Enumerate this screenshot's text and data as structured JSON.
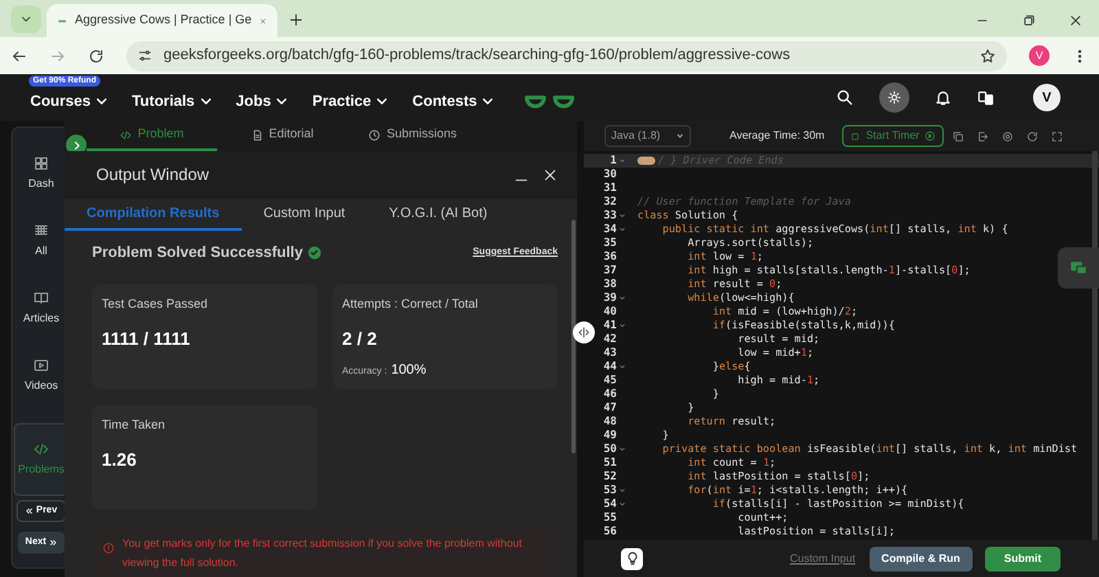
{
  "browser": {
    "tab_title": "Aggressive Cows | Practice | Ge",
    "url": "geeksforgeeks.org/batch/gfg-160-problems/track/searching-gfg-160/problem/aggressive-cows",
    "profile": "V"
  },
  "nav": {
    "badge": "Get 90% Refund",
    "menu": [
      "Courses",
      "Tutorials",
      "Jobs",
      "Practice",
      "Contests"
    ],
    "profile": "V"
  },
  "sidebar": {
    "items": [
      {
        "label": "Dash",
        "kind": "dash",
        "selected": false
      },
      {
        "label": "All",
        "kind": "all",
        "selected": false
      },
      {
        "label": "Articles",
        "kind": "articles",
        "selected": false
      },
      {
        "label": "Videos",
        "kind": "videos",
        "selected": false
      },
      {
        "label": "Problems",
        "kind": "problems",
        "selected": true
      }
    ],
    "prev": "Prev",
    "next": "Next"
  },
  "panel_tabs": [
    {
      "label": "Problem",
      "kind": "code",
      "selected": true
    },
    {
      "label": "Editorial",
      "kind": "doc",
      "selected": false
    },
    {
      "label": "Submissions",
      "kind": "clock",
      "selected": false
    }
  ],
  "output_window": {
    "title": "Output Window",
    "tabs": [
      {
        "label": "Compilation Results",
        "selected": true
      },
      {
        "label": "Custom Input",
        "selected": false
      },
      {
        "label": "Y.O.G.I. (AI Bot)",
        "selected": false
      }
    ],
    "status": "Problem Solved Successfully",
    "feedback": "Suggest Feedback",
    "cards": [
      {
        "label": "Test Cases Passed",
        "value": "1111 / 1111"
      },
      {
        "label": "Attempts : Correct / Total",
        "value": "2 / 2",
        "extra_label": "Accuracy :",
        "extra_value": "100%"
      },
      {
        "label": "Time Taken",
        "value": "1.26"
      }
    ],
    "note": "You get marks only for the first correct submission if you solve the problem without viewing the full solution."
  },
  "editor": {
    "language": "Java (1.8)",
    "average_time": "Average Time: 30m",
    "timer": "Start Timer",
    "lines": [
      {
        "number": "1",
        "foldable": true,
        "active": true,
        "folded": true,
        "tokens": [
          {
            "kind": "comment",
            "text": "/ } Driver Code Ends"
          }
        ]
      },
      {
        "number": "30",
        "foldable": false,
        "active": false
      },
      {
        "number": "31",
        "foldable": false,
        "active": false
      },
      {
        "number": "32",
        "foldable": false,
        "active": false,
        "tokens": [
          {
            "kind": "comment",
            "text": "// User function Template for Java"
          }
        ]
      },
      {
        "number": "33",
        "foldable": true,
        "active": false,
        "tokens": [
          {
            "kind": "keyword",
            "text": "class"
          },
          {
            "kind": "plain",
            "text": " Solution {"
          }
        ]
      },
      {
        "number": "34",
        "foldable": true,
        "active": false,
        "tokens": [
          {
            "kind": "keyword",
            "text": "    public static int"
          },
          {
            "kind": "plain",
            "text": " aggressiveCows("
          },
          {
            "kind": "keyword",
            "text": "int"
          },
          {
            "kind": "plain",
            "text": "[] stalls, "
          },
          {
            "kind": "keyword",
            "text": "int"
          },
          {
            "kind": "plain",
            "text": " k) {"
          }
        ]
      },
      {
        "number": "35",
        "foldable": false,
        "active": false,
        "tokens": [
          {
            "kind": "plain",
            "text": "        Arrays.sort(stalls);"
          }
        ]
      },
      {
        "number": "36",
        "foldable": false,
        "active": false,
        "tokens": [
          {
            "kind": "keyword",
            "text": "        int"
          },
          {
            "kind": "plain",
            "text": " low = "
          },
          {
            "kind": "number",
            "text": "1"
          },
          {
            "kind": "plain",
            "text": ";"
          }
        ]
      },
      {
        "number": "37",
        "foldable": false,
        "active": false,
        "tokens": [
          {
            "kind": "keyword",
            "text": "        int"
          },
          {
            "kind": "plain",
            "text": " high = stalls[stalls.length-"
          },
          {
            "kind": "number",
            "text": "1"
          },
          {
            "kind": "plain",
            "text": "]-stalls["
          },
          {
            "kind": "number",
            "text": "0"
          },
          {
            "kind": "plain",
            "text": "];"
          }
        ]
      },
      {
        "number": "38",
        "foldable": false,
        "active": false,
        "tokens": [
          {
            "kind": "keyword",
            "text": "        int"
          },
          {
            "kind": "plain",
            "text": " result = "
          },
          {
            "kind": "number",
            "text": "0"
          },
          {
            "kind": "plain",
            "text": ";"
          }
        ]
      },
      {
        "number": "39",
        "foldable": true,
        "active": false,
        "tokens": [
          {
            "kind": "keyword",
            "text": "        while"
          },
          {
            "kind": "plain",
            "text": "(low<=high){"
          }
        ]
      },
      {
        "number": "40",
        "foldable": false,
        "active": false,
        "tokens": [
          {
            "kind": "keyword",
            "text": "            int"
          },
          {
            "kind": "plain",
            "text": " mid = (low+high)/"
          },
          {
            "kind": "number",
            "text": "2"
          },
          {
            "kind": "plain",
            "text": ";"
          }
        ]
      },
      {
        "number": "41",
        "foldable": true,
        "active": false,
        "tokens": [
          {
            "kind": "keyword",
            "text": "            if"
          },
          {
            "kind": "plain",
            "text": "(isFeasible(stalls,k,mid)){"
          }
        ]
      },
      {
        "number": "42",
        "foldable": false,
        "active": false,
        "tokens": [
          {
            "kind": "plain",
            "text": "                result = mid;"
          }
        ]
      },
      {
        "number": "43",
        "foldable": false,
        "active": false,
        "tokens": [
          {
            "kind": "plain",
            "text": "                low = mid+"
          },
          {
            "kind": "number",
            "text": "1"
          },
          {
            "kind": "plain",
            "text": ";"
          }
        ]
      },
      {
        "number": "44",
        "foldable": true,
        "active": false,
        "tokens": [
          {
            "kind": "plain",
            "text": "            }"
          },
          {
            "kind": "keyword",
            "text": "else"
          },
          {
            "kind": "plain",
            "text": "{"
          }
        ]
      },
      {
        "number": "45",
        "foldable": false,
        "active": false,
        "tokens": [
          {
            "kind": "plain",
            "text": "                high = mid-"
          },
          {
            "kind": "number",
            "text": "1"
          },
          {
            "kind": "plain",
            "text": ";"
          }
        ]
      },
      {
        "number": "46",
        "foldable": false,
        "active": false,
        "tokens": [
          {
            "kind": "plain",
            "text": "            }"
          }
        ]
      },
      {
        "number": "47",
        "foldable": false,
        "active": false,
        "tokens": [
          {
            "kind": "plain",
            "text": "        }"
          }
        ]
      },
      {
        "number": "48",
        "foldable": false,
        "active": false,
        "tokens": [
          {
            "kind": "keyword",
            "text": "        return"
          },
          {
            "kind": "plain",
            "text": " result;"
          }
        ]
      },
      {
        "number": "49",
        "foldable": false,
        "active": false,
        "tokens": [
          {
            "kind": "plain",
            "text": "    }"
          }
        ]
      },
      {
        "number": "50",
        "foldable": true,
        "active": false,
        "tokens": [
          {
            "kind": "keyword",
            "text": "    private static boolean"
          },
          {
            "kind": "plain",
            "text": " isFeasible("
          },
          {
            "kind": "keyword",
            "text": "int"
          },
          {
            "kind": "plain",
            "text": "[] stalls, "
          },
          {
            "kind": "keyword",
            "text": "int"
          },
          {
            "kind": "plain",
            "text": " k, "
          },
          {
            "kind": "keyword",
            "text": "int"
          },
          {
            "kind": "plain",
            "text": " minDist"
          }
        ]
      },
      {
        "number": "51",
        "foldable": false,
        "active": false,
        "tokens": [
          {
            "kind": "keyword",
            "text": "        int"
          },
          {
            "kind": "plain",
            "text": " count = "
          },
          {
            "kind": "number",
            "text": "1"
          },
          {
            "kind": "plain",
            "text": ";"
          }
        ]
      },
      {
        "number": "52",
        "foldable": false,
        "active": false,
        "tokens": [
          {
            "kind": "keyword",
            "text": "        int"
          },
          {
            "kind": "plain",
            "text": " lastPosition = stalls["
          },
          {
            "kind": "number",
            "text": "0"
          },
          {
            "kind": "plain",
            "text": "];"
          }
        ]
      },
      {
        "number": "53",
        "foldable": true,
        "active": false,
        "tokens": [
          {
            "kind": "keyword",
            "text": "        for"
          },
          {
            "kind": "plain",
            "text": "("
          },
          {
            "kind": "keyword",
            "text": "int"
          },
          {
            "kind": "plain",
            "text": " i="
          },
          {
            "kind": "number",
            "text": "1"
          },
          {
            "kind": "plain",
            "text": "; i<stalls.length; i++){"
          }
        ]
      },
      {
        "number": "54",
        "foldable": true,
        "active": false,
        "tokens": [
          {
            "kind": "keyword",
            "text": "            if"
          },
          {
            "kind": "plain",
            "text": "(stalls[i] - lastPosition >= minDist){"
          }
        ]
      },
      {
        "number": "55",
        "foldable": false,
        "active": false,
        "tokens": [
          {
            "kind": "plain",
            "text": "                count++;"
          }
        ]
      },
      {
        "number": "56",
        "foldable": false,
        "active": false,
        "tokens": [
          {
            "kind": "plain",
            "text": "                lastPosition = stalls[i];"
          }
        ]
      }
    ],
    "custom_input": "Custom Input",
    "compile": "Compile & Run",
    "submit": "Submit"
  }
}
